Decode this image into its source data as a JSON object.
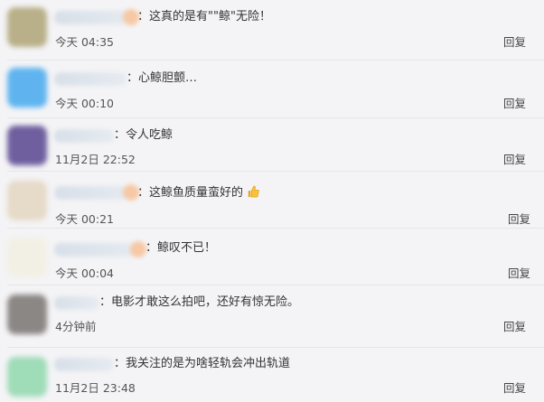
{
  "reply_label": "回复",
  "comments": [
    {
      "text": "：这真的是有\"\"鲸\"无险！",
      "time": "今天 04:35",
      "avatar_color": "#b9b089"
    },
    {
      "text": "：心鲸胆颤…",
      "time": "今天 00:10",
      "avatar_color": "#5fb4ef"
    },
    {
      "text": "：令人吃鲸",
      "time": "11月2日 22:52",
      "avatar_color": "#6f5f9f"
    },
    {
      "text": "：这鲸鱼质量蛮好的",
      "time": "今天 00:21",
      "avatar_color": "#e6dac8",
      "emoji": "thumbs-up-icon"
    },
    {
      "text": "：鲸叹不已！",
      "time": "今天 00:04",
      "avatar_color": "#f2f0e4"
    },
    {
      "text": "：电影才敢这么拍吧，还好有惊无险。",
      "time": "4分钟前",
      "avatar_color": "#8b8785"
    },
    {
      "text": "：我关注的是为啥轻轨会冲出轨道",
      "time": "11月2日 23:48",
      "avatar_color": "#9fdcb8"
    }
  ]
}
